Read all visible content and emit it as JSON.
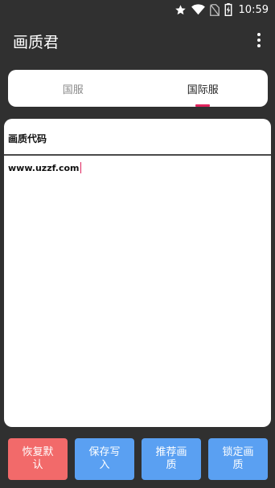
{
  "status_bar": {
    "time": "10:59",
    "icons": [
      "star-icon",
      "wifi-icon",
      "no-sim-icon",
      "battery-charging-icon"
    ]
  },
  "app": {
    "title": "画质君"
  },
  "tabs": [
    {
      "label": "国服",
      "active": false
    },
    {
      "label": "国际服",
      "active": true
    }
  ],
  "panel": {
    "label": "画质代码",
    "code_value": "www.uzzf.com"
  },
  "buttons": {
    "restore": "恢复默认",
    "save": "保存写入",
    "recommend": "推荐画质",
    "lock": "锁定画质"
  },
  "colors": {
    "background": "#303030",
    "accent": "#e0245e",
    "restore_button": "#f26a6a",
    "action_button": "#5aa0f2"
  }
}
